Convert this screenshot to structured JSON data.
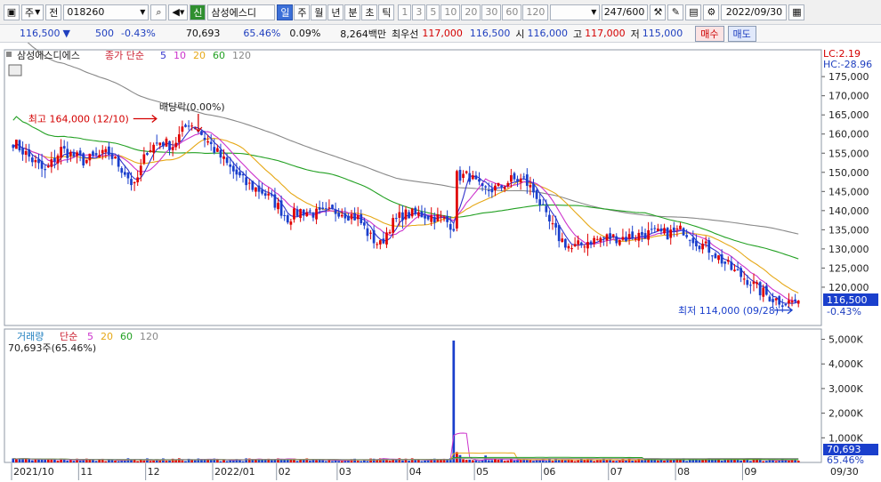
{
  "toolbar": {
    "period_label": "주",
    "prev_label": "전",
    "stock_code": "018260",
    "credit_badge": "신",
    "stock_name": "삼성에스디",
    "periods": [
      "일",
      "주",
      "월",
      "년",
      "분",
      "초",
      "틱"
    ],
    "active_period": "일",
    "minute_steps": [
      "1",
      "3",
      "5",
      "10",
      "20",
      "30",
      "60",
      "120"
    ],
    "count": "247/600",
    "date": "2022/09/30"
  },
  "infobar": {
    "price": "116,500",
    "change": "500",
    "change_pct": "-0.43%",
    "volume": "70,693",
    "volume_ratio": "65.46%",
    "turnover_pct": "0.09%",
    "amount": "8,264백만",
    "pref_label": "최우선",
    "ask": "117,000",
    "bid": "116,500",
    "open_label": "시",
    "open": "116,000",
    "high_label": "고",
    "high": "117,000",
    "low_label": "저",
    "low": "115,000",
    "buy_label": "매수",
    "sell_label": "매도"
  },
  "colors": {
    "up": "#e00000",
    "down": "#1a3fcc",
    "ma5": "#3333cc",
    "ma10": "#cc33cc",
    "ma20": "#e6a817",
    "ma60": "#22a022",
    "ma120": "#888888"
  },
  "chart_data": [
    {
      "type": "candlestick",
      "legend_name": "삼성에스디에스",
      "legend_ma_label": "종가 단순",
      "ma_periods": [
        "5",
        "10",
        "20",
        "60",
        "120"
      ],
      "ylim": [
        110000,
        182000
      ],
      "yticks": [
        "120,000",
        "125,000",
        "130,000",
        "135,000",
        "140,000",
        "145,000",
        "150,000",
        "155,000",
        "160,000",
        "165,000",
        "170,000",
        "175,000"
      ],
      "corner_labels": [
        "LC:2.19",
        "HC:-28.96"
      ],
      "last_price_label": "116,500",
      "last_change_label": "-0.43%",
      "annotations": {
        "high": "최고 164,000 (12/10)",
        "dividend": "배당락(0.00%)",
        "low": "최저 114,000 (09/28)"
      },
      "x_labels": [
        "2021/10",
        "11",
        "12",
        "2022/01",
        "02",
        "03",
        "04",
        "05",
        "06",
        "07",
        "08",
        "09"
      ],
      "x_end_label": "09/30",
      "anchors": [
        [
          0,
          158000
        ],
        [
          5,
          154000
        ],
        [
          10,
          150000
        ],
        [
          15,
          156000
        ],
        [
          22,
          153000
        ],
        [
          30,
          155000
        ],
        [
          35,
          150000
        ],
        [
          38,
          146000
        ],
        [
          42,
          156000
        ],
        [
          46,
          158000
        ],
        [
          50,
          157000
        ],
        [
          55,
          163000
        ],
        [
          57,
          162000
        ],
        [
          60,
          159000
        ],
        [
          64,
          155000
        ],
        [
          68,
          151000
        ],
        [
          73,
          147000
        ],
        [
          78,
          145000
        ],
        [
          82,
          142000
        ],
        [
          86,
          138000
        ],
        [
          90,
          140000
        ],
        [
          96,
          139000
        ],
        [
          102,
          140000
        ],
        [
          108,
          138000
        ],
        [
          112,
          133000
        ],
        [
          115,
          131000
        ],
        [
          118,
          136000
        ],
        [
          122,
          139000
        ],
        [
          128,
          139000
        ],
        [
          134,
          138000
        ],
        [
          138,
          136000
        ],
        [
          139,
          149000
        ],
        [
          143,
          149000
        ],
        [
          147,
          145000
        ],
        [
          152,
          146000
        ],
        [
          156,
          148000
        ],
        [
          160,
          148000
        ],
        [
          164,
          144000
        ],
        [
          167,
          138000
        ],
        [
          171,
          133000
        ],
        [
          175,
          130000
        ],
        [
          180,
          132000
        ],
        [
          186,
          133000
        ],
        [
          192,
          133000
        ],
        [
          198,
          134000
        ],
        [
          205,
          134000
        ],
        [
          210,
          135000
        ],
        [
          214,
          132000
        ],
        [
          218,
          130000
        ],
        [
          222,
          127000
        ],
        [
          226,
          124000
        ],
        [
          230,
          122000
        ],
        [
          234,
          119000
        ],
        [
          238,
          117000
        ],
        [
          242,
          116000
        ],
        [
          246,
          116500
        ]
      ]
    },
    {
      "type": "bar",
      "legend_name": "거래량",
      "legend_ma_label": "단순",
      "ma_periods": [
        "5",
        "20",
        "60",
        "120"
      ],
      "legend_value": "70,693주(65.46%)",
      "ylim": [
        0,
        5200000
      ],
      "yticks": [
        "1,000K",
        "2,000K",
        "3,000K",
        "4,000K",
        "5,000K"
      ],
      "last_value_label": "70,693",
      "last_ratio_label": "65.46%",
      "spikes": [
        [
          138,
          4950000
        ],
        [
          139,
          420000
        ],
        [
          140,
          300000
        ],
        [
          148,
          280000
        ]
      ],
      "base_volume": 100000,
      "latest": 70693
    }
  ]
}
